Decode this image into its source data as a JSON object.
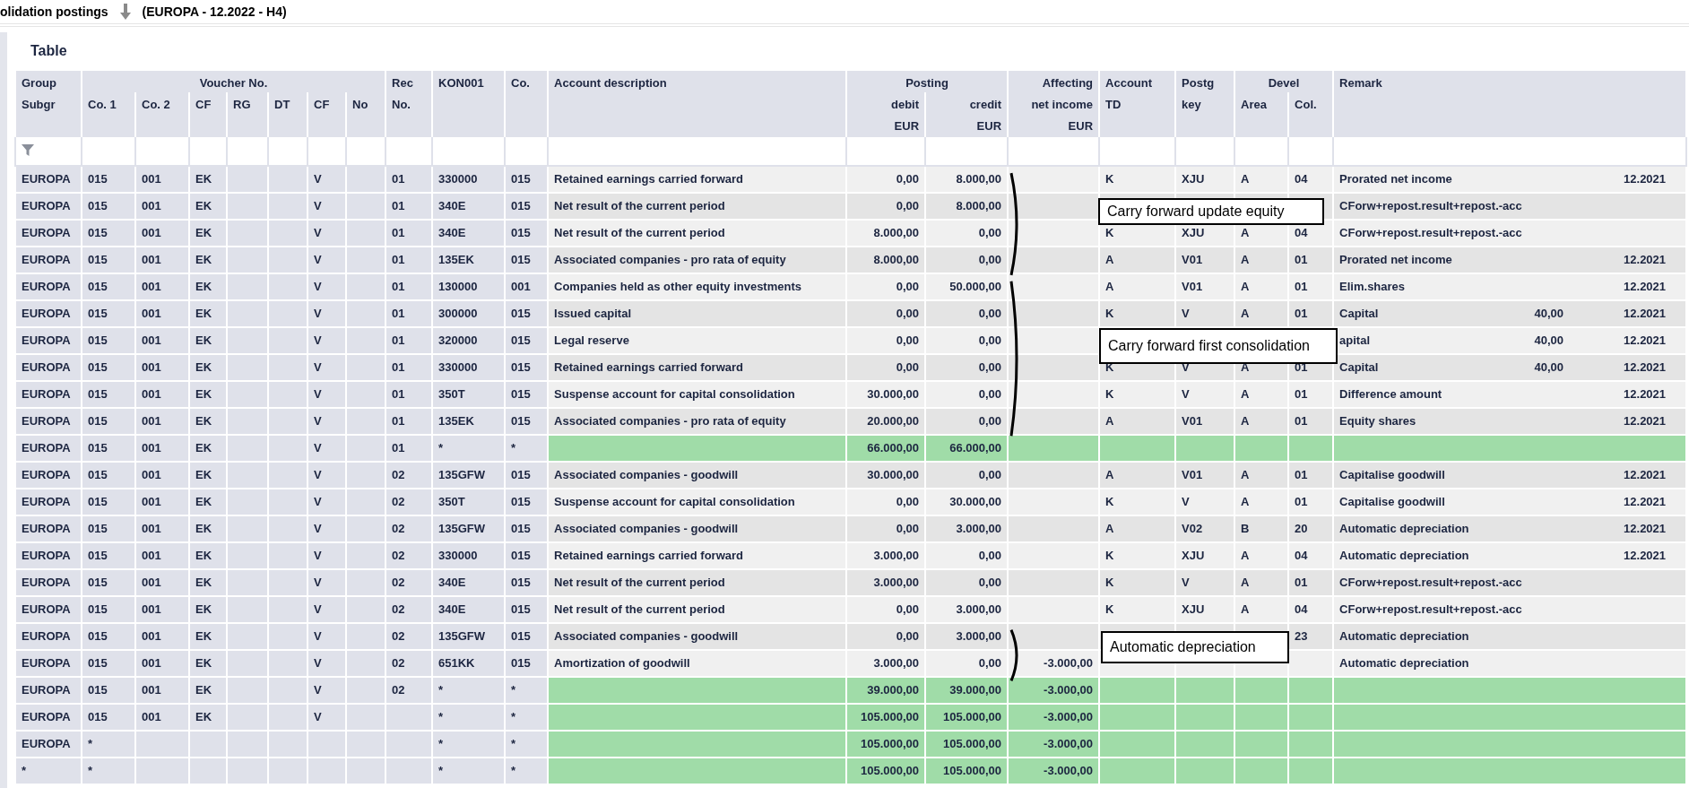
{
  "title_bar": {
    "title": "olidation postings",
    "context": "(EUROPA - 12.2022 - H4)"
  },
  "section_title": "Table",
  "header_groups": [
    {
      "label": "Group",
      "columns": [
        {
          "label": "Subgr"
        }
      ]
    },
    {
      "label": "Voucher No.",
      "columns": [
        {
          "label": "Co. 1"
        },
        {
          "label": "Co. 2"
        },
        {
          "label": "CF"
        },
        {
          "label": "RG"
        },
        {
          "label": "DT"
        },
        {
          "label": "CF"
        },
        {
          "label": "No"
        }
      ]
    },
    {
      "label": "Rec",
      "columns": [
        {
          "label": "No."
        }
      ]
    },
    {
      "label": "KON001"
    },
    {
      "label": "Co."
    },
    {
      "label": "Account description"
    },
    {
      "label": "Posting",
      "columns": [
        {
          "label": "debit",
          "unit": "EUR"
        },
        {
          "label": "credit",
          "unit": "EUR"
        }
      ]
    },
    {
      "label": "Affecting",
      "columns": [
        {
          "label": "net income",
          "unit": "EUR"
        }
      ]
    },
    {
      "label": "Account",
      "columns": [
        {
          "label": "TD"
        }
      ]
    },
    {
      "label": "Postg",
      "columns": [
        {
          "label": "key"
        }
      ]
    },
    {
      "label": "Devel",
      "columns": [
        {
          "label": "Area"
        },
        {
          "label": "Col."
        }
      ]
    },
    {
      "label": "Remark"
    }
  ],
  "rows": [
    {
      "kind": "posting",
      "group": "EUROPA",
      "co_1": "015",
      "co_2": "001",
      "cf": "EK",
      "cf_2": "V",
      "rec_no": "01",
      "kon001": "330000",
      "co": "015",
      "description": "Retained earnings carried forward",
      "debit": "0,00",
      "credit": "8.000,00",
      "account_td": "K",
      "postg_key": "XJU",
      "area": "A",
      "col": "04",
      "remark": "Prorated net income",
      "remark_period": "12.2021"
    },
    {
      "kind": "posting",
      "group": "EUROPA",
      "co_1": "015",
      "co_2": "001",
      "cf": "EK",
      "cf_2": "V",
      "rec_no": "01",
      "kon001": "340E",
      "co": "015",
      "description": "Net result of the current period",
      "debit": "0,00",
      "credit": "8.000,00",
      "remark": "CForw+repost.result+repost.-acc"
    },
    {
      "kind": "posting",
      "group": "EUROPA",
      "co_1": "015",
      "co_2": "001",
      "cf": "EK",
      "cf_2": "V",
      "rec_no": "01",
      "kon001": "340E",
      "co": "015",
      "description": "Net result of the current period",
      "debit": "8.000,00",
      "credit": "0,00",
      "account_td": "K",
      "postg_key": "XJU",
      "area": "A",
      "col": "04",
      "remark": "CForw+repost.result+repost.-acc"
    },
    {
      "kind": "posting",
      "group": "EUROPA",
      "co_1": "015",
      "co_2": "001",
      "cf": "EK",
      "cf_2": "V",
      "rec_no": "01",
      "kon001": "135EK",
      "co": "015",
      "description": "Associated companies - pro rata of equity",
      "debit": "8.000,00",
      "credit": "0,00",
      "account_td": "A",
      "postg_key": "V01",
      "area": "A",
      "col": "01",
      "remark": "Prorated net income",
      "remark_period": "12.2021"
    },
    {
      "kind": "posting",
      "group": "EUROPA",
      "co_1": "015",
      "co_2": "001",
      "cf": "EK",
      "cf_2": "V",
      "rec_no": "01",
      "kon001": "130000",
      "co": "001",
      "description": "Companies held as other equity investments",
      "debit": "0,00",
      "credit": "50.000,00",
      "account_td": "A",
      "postg_key": "V01",
      "area": "A",
      "col": "01",
      "remark": "Elim.shares",
      "remark_period": "12.2021"
    },
    {
      "kind": "posting",
      "group": "EUROPA",
      "co_1": "015",
      "co_2": "001",
      "cf": "EK",
      "cf_2": "V",
      "rec_no": "01",
      "kon001": "300000",
      "co": "015",
      "description": "Issued capital",
      "debit": "0,00",
      "credit": "0,00",
      "account_td": "K",
      "postg_key": "V",
      "area": "A",
      "col": "01",
      "remark": "Capital",
      "remark_amount": "40,00",
      "remark_period": "12.2021"
    },
    {
      "kind": "posting",
      "group": "EUROPA",
      "co_1": "015",
      "co_2": "001",
      "cf": "EK",
      "cf_2": "V",
      "rec_no": "01",
      "kon001": "320000",
      "co": "015",
      "description": "Legal reserve",
      "debit": "0,00",
      "credit": "0,00",
      "remark": "apital",
      "remark_amount": "40,00",
      "remark_period": "12.2021"
    },
    {
      "kind": "posting",
      "group": "EUROPA",
      "co_1": "015",
      "co_2": "001",
      "cf": "EK",
      "cf_2": "V",
      "rec_no": "01",
      "kon001": "330000",
      "co": "015",
      "description": "Retained earnings carried forward",
      "debit": "0,00",
      "credit": "0,00",
      "account_td": "K",
      "postg_key": "V",
      "area": "A",
      "col": "01",
      "remark": "Capital",
      "remark_amount": "40,00",
      "remark_period": "12.2021"
    },
    {
      "kind": "posting",
      "group": "EUROPA",
      "co_1": "015",
      "co_2": "001",
      "cf": "EK",
      "cf_2": "V",
      "rec_no": "01",
      "kon001": "350T",
      "co": "015",
      "description": "Suspense account for capital consolidation",
      "debit": "30.000,00",
      "credit": "0,00",
      "account_td": "K",
      "postg_key": "V",
      "area": "A",
      "col": "01",
      "remark": "Difference amount",
      "remark_period": "12.2021"
    },
    {
      "kind": "posting",
      "group": "EUROPA",
      "co_1": "015",
      "co_2": "001",
      "cf": "EK",
      "cf_2": "V",
      "rec_no": "01",
      "kon001": "135EK",
      "co": "015",
      "description": "Associated companies - pro rata of equity",
      "debit": "20.000,00",
      "credit": "0,00",
      "account_td": "A",
      "postg_key": "V01",
      "area": "A",
      "col": "01",
      "remark": "Equity shares",
      "remark_period": "12.2021"
    },
    {
      "kind": "total",
      "group": "EUROPA",
      "co_1": "015",
      "co_2": "001",
      "cf": "EK",
      "cf_2": "V",
      "rec_no": "01",
      "kon001": "*",
      "co": "*",
      "debit": "66.000,00",
      "credit": "66.000,00"
    },
    {
      "kind": "posting",
      "group": "EUROPA",
      "co_1": "015",
      "co_2": "001",
      "cf": "EK",
      "cf_2": "V",
      "rec_no": "02",
      "kon001": "135GFW",
      "co": "015",
      "description": "Associated companies - goodwill",
      "debit": "30.000,00",
      "credit": "0,00",
      "account_td": "A",
      "postg_key": "V01",
      "area": "A",
      "col": "01",
      "remark": "Capitalise goodwill",
      "remark_period": "12.2021"
    },
    {
      "kind": "posting",
      "group": "EUROPA",
      "co_1": "015",
      "co_2": "001",
      "cf": "EK",
      "cf_2": "V",
      "rec_no": "02",
      "kon001": "350T",
      "co": "015",
      "description": "Suspense account for capital consolidation",
      "debit": "0,00",
      "credit": "30.000,00",
      "account_td": "K",
      "postg_key": "V",
      "area": "A",
      "col": "01",
      "remark": "Capitalise goodwill",
      "remark_period": "12.2021"
    },
    {
      "kind": "posting",
      "group": "EUROPA",
      "co_1": "015",
      "co_2": "001",
      "cf": "EK",
      "cf_2": "V",
      "rec_no": "02",
      "kon001": "135GFW",
      "co": "015",
      "description": "Associated companies - goodwill",
      "debit": "0,00",
      "credit": "3.000,00",
      "account_td": "A",
      "postg_key": "V02",
      "area": "B",
      "col": "20",
      "remark": "Automatic depreciation",
      "remark_period": "12.2021"
    },
    {
      "kind": "posting",
      "group": "EUROPA",
      "co_1": "015",
      "co_2": "001",
      "cf": "EK",
      "cf_2": "V",
      "rec_no": "02",
      "kon001": "330000",
      "co": "015",
      "description": "Retained earnings carried forward",
      "debit": "3.000,00",
      "credit": "0,00",
      "account_td": "K",
      "postg_key": "XJU",
      "area": "A",
      "col": "04",
      "remark": "Automatic depreciation",
      "remark_period": "12.2021"
    },
    {
      "kind": "posting",
      "group": "EUROPA",
      "co_1": "015",
      "co_2": "001",
      "cf": "EK",
      "cf_2": "V",
      "rec_no": "02",
      "kon001": "340E",
      "co": "015",
      "description": "Net result of the current period",
      "debit": "3.000,00",
      "credit": "0,00",
      "account_td": "K",
      "postg_key": "V",
      "area": "A",
      "col": "01",
      "remark": "CForw+repost.result+repost.-acc"
    },
    {
      "kind": "posting",
      "group": "EUROPA",
      "co_1": "015",
      "co_2": "001",
      "cf": "EK",
      "cf_2": "V",
      "rec_no": "02",
      "kon001": "340E",
      "co": "015",
      "description": "Net result of the current period",
      "debit": "0,00",
      "credit": "3.000,00",
      "account_td": "K",
      "postg_key": "XJU",
      "area": "A",
      "col": "04",
      "remark": "CForw+repost.result+repost.-acc"
    },
    {
      "kind": "posting",
      "group": "EUROPA",
      "co_1": "015",
      "co_2": "001",
      "cf": "EK",
      "cf_2": "V",
      "rec_no": "02",
      "kon001": "135GFW",
      "co": "015",
      "description": "Associated companies - goodwill",
      "debit": "0,00",
      "credit": "3.000,00",
      "col": "23",
      "remark": "Automatic depreciation"
    },
    {
      "kind": "posting",
      "group": "EUROPA",
      "co_1": "015",
      "co_2": "001",
      "cf": "EK",
      "cf_2": "V",
      "rec_no": "02",
      "kon001": "651KK",
      "co": "015",
      "description": "Amortization of goodwill",
      "debit": "3.000,00",
      "credit": "0,00",
      "net_income": "-3.000,00",
      "remark": "Automatic depreciation"
    },
    {
      "kind": "total",
      "group": "EUROPA",
      "co_1": "015",
      "co_2": "001",
      "cf": "EK",
      "cf_2": "V",
      "rec_no": "02",
      "kon001": "*",
      "co": "*",
      "debit": "39.000,00",
      "credit": "39.000,00",
      "net_income": "-3.000,00"
    },
    {
      "kind": "total",
      "group": "EUROPA",
      "co_1": "015",
      "co_2": "001",
      "cf": "EK",
      "cf_2": "V",
      "kon001": "*",
      "co": "*",
      "debit": "105.000,00",
      "credit": "105.000,00",
      "net_income": "-3.000,00"
    },
    {
      "kind": "total",
      "group": "EUROPA",
      "co_1": "*",
      "kon001": "*",
      "co": "*",
      "debit": "105.000,00",
      "credit": "105.000,00",
      "net_income": "-3.000,00"
    },
    {
      "kind": "total",
      "group": "*",
      "co_1": "*",
      "kon001": "*",
      "co": "*",
      "debit": "105.000,00",
      "credit": "105.000,00",
      "net_income": "-3.000,00"
    }
  ],
  "annotations": [
    {
      "text": "Carry forward update equity"
    },
    {
      "text": "Carry forward first consolidation"
    },
    {
      "text": "Automatic depreciation"
    }
  ]
}
